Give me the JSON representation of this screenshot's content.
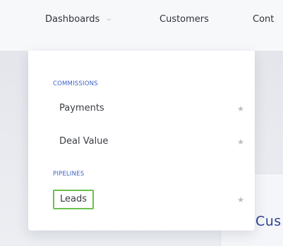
{
  "nav": {
    "dashboards": "Dashboards",
    "customers": "Customers",
    "contacts_partial": "Cont"
  },
  "dropdown": {
    "sections": [
      {
        "label": "COMMISSIONS",
        "items": [
          {
            "label": "Payments",
            "icon": "star-icon"
          },
          {
            "label": "Deal Value",
            "icon": "star-icon"
          }
        ]
      },
      {
        "label": "PIPELINES",
        "items": [
          {
            "label": "Leads",
            "icon": "star-icon",
            "highlighted": true
          }
        ]
      }
    ]
  },
  "background": {
    "card_title_partial": "Cus"
  },
  "colors": {
    "section_label": "#3b63c4",
    "highlight_border": "#6cc04a",
    "card_title": "#2e3f8f"
  }
}
